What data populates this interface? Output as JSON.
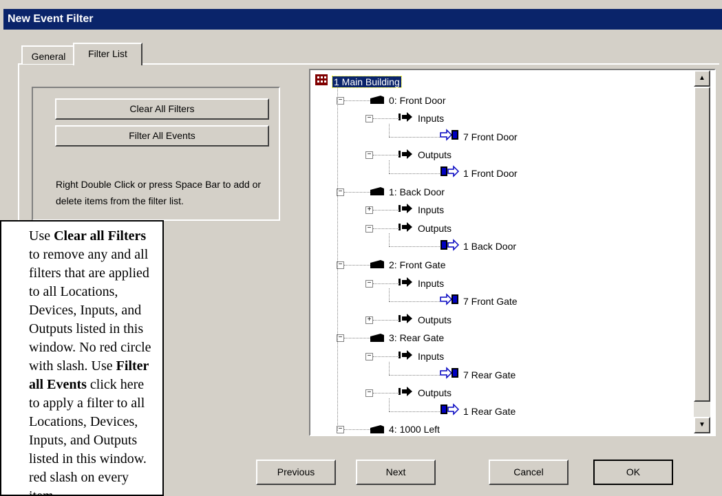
{
  "window": {
    "title": "New Event Filter"
  },
  "tabs": [
    {
      "label": "General"
    },
    {
      "label": "Filter List"
    }
  ],
  "buttons": {
    "clear_all": "Clear All Filters",
    "filter_all": "Filter All Events"
  },
  "help_text": "Right Double Click or press Space Bar to add or delete items from the filter list.",
  "tree": [
    {
      "label": "1  Main Building",
      "icon": "building-icon",
      "level": 0,
      "selected": true
    },
    {
      "label": "0: Front Door",
      "icon": "door-icon",
      "level": 1,
      "toggle": "-"
    },
    {
      "label": "Inputs",
      "icon": "arrow-right-icon",
      "level": 2,
      "toggle": "-"
    },
    {
      "label": "7  Front Door",
      "icon": "input-icon",
      "level": 3
    },
    {
      "label": "Outputs",
      "icon": "arrow-right-icon",
      "level": 2,
      "toggle": "-"
    },
    {
      "label": "1  Front Door",
      "icon": "output-icon",
      "level": 3
    },
    {
      "label": "1: Back Door",
      "icon": "door-icon",
      "level": 1,
      "toggle": "-"
    },
    {
      "label": "Inputs",
      "icon": "arrow-right-icon",
      "level": 2,
      "toggle": "+"
    },
    {
      "label": "Outputs",
      "icon": "arrow-right-icon",
      "level": 2,
      "toggle": "-"
    },
    {
      "label": "1  Back Door",
      "icon": "output-icon",
      "level": 3
    },
    {
      "label": "2: Front Gate",
      "icon": "door-icon",
      "level": 1,
      "toggle": "-"
    },
    {
      "label": "Inputs",
      "icon": "arrow-right-icon",
      "level": 2,
      "toggle": "-"
    },
    {
      "label": "7  Front Gate",
      "icon": "input-icon",
      "level": 3
    },
    {
      "label": "Outputs",
      "icon": "arrow-right-icon",
      "level": 2,
      "toggle": "+"
    },
    {
      "label": "3: Rear Gate",
      "icon": "door-icon",
      "level": 1,
      "toggle": "-"
    },
    {
      "label": "Inputs",
      "icon": "arrow-right-icon",
      "level": 2,
      "toggle": "-"
    },
    {
      "label": "7  Rear Gate",
      "icon": "input-icon",
      "level": 3
    },
    {
      "label": "Outputs",
      "icon": "arrow-right-icon",
      "level": 2,
      "toggle": "-"
    },
    {
      "label": "1  Rear Gate",
      "icon": "output-icon",
      "level": 3
    },
    {
      "label": "4: 1000 Left",
      "icon": "door-icon",
      "level": 1,
      "toggle": "-"
    }
  ],
  "footer_buttons": {
    "previous": "Previous",
    "next": "Next",
    "cancel": "Cancel",
    "ok": "OK"
  },
  "callout": {
    "part1": "Use ",
    "bold1": "Clear all Filters",
    "part2": " to remove any and all filters that are applied to all Locations, Devices, Inputs, and Outputs listed in this window. No red circle with slash. Use ",
    "bold2": "Filter all Events",
    "part3": " click here to apply a filter to all Locations, Devices, Inputs, and Outputs listed in this window. red slash on every item."
  },
  "colors": {
    "titlebar": "#0a246a",
    "selection": "#0a246a",
    "face": "#d4d0c8"
  }
}
